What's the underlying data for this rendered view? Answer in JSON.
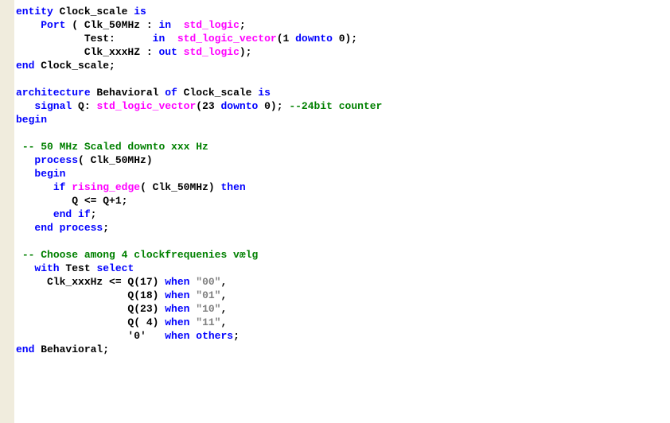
{
  "tokens": [
    [
      [
        "kw",
        "entity"
      ],
      [
        "id",
        " Clock_scale "
      ],
      [
        "kw",
        "is"
      ]
    ],
    [
      [
        "id",
        "    "
      ],
      [
        "kw",
        "Port"
      ],
      [
        "id",
        " ( Clk_50MHz : "
      ],
      [
        "kw",
        "in"
      ],
      [
        "id",
        "  "
      ],
      [
        "type",
        "std_logic"
      ],
      [
        "id",
        ";"
      ]
    ],
    [
      [
        "id",
        "           Test:      "
      ],
      [
        "kw",
        "in"
      ],
      [
        "id",
        "  "
      ],
      [
        "type",
        "std_logic_vector"
      ],
      [
        "id",
        "(1 "
      ],
      [
        "kw",
        "downto"
      ],
      [
        "id",
        " 0);"
      ]
    ],
    [
      [
        "id",
        "           Clk_xxxHZ : "
      ],
      [
        "kw",
        "out"
      ],
      [
        "id",
        " "
      ],
      [
        "type",
        "std_logic"
      ],
      [
        "id",
        ");"
      ]
    ],
    [
      [
        "kw",
        "end"
      ],
      [
        "id",
        " Clock_scale;"
      ]
    ],
    [],
    [
      [
        "kw",
        "architecture"
      ],
      [
        "id",
        " Behavioral "
      ],
      [
        "kw",
        "of"
      ],
      [
        "id",
        " Clock_scale "
      ],
      [
        "kw",
        "is"
      ]
    ],
    [
      [
        "id",
        "   "
      ],
      [
        "kw",
        "signal"
      ],
      [
        "id",
        " Q: "
      ],
      [
        "type",
        "std_logic_vector"
      ],
      [
        "id",
        "(23 "
      ],
      [
        "kw",
        "downto"
      ],
      [
        "id",
        " 0); "
      ],
      [
        "cmt",
        "--24bit counter"
      ]
    ],
    [
      [
        "kw",
        "begin"
      ]
    ],
    [],
    [
      [
        "id",
        " "
      ],
      [
        "cmt",
        "-- 50 MHz Scaled downto xxx Hz"
      ]
    ],
    [
      [
        "id",
        "   "
      ],
      [
        "kw",
        "process"
      ],
      [
        "id",
        "( Clk_50MHz)"
      ]
    ],
    [
      [
        "id",
        "   "
      ],
      [
        "kw",
        "begin"
      ]
    ],
    [
      [
        "id",
        "      "
      ],
      [
        "kw",
        "if"
      ],
      [
        "id",
        " "
      ],
      [
        "type",
        "rising_edge"
      ],
      [
        "id",
        "( Clk_50MHz) "
      ],
      [
        "kw",
        "then"
      ]
    ],
    [
      [
        "id",
        "         Q <= Q+1;"
      ]
    ],
    [
      [
        "id",
        "      "
      ],
      [
        "kw",
        "end"
      ],
      [
        "id",
        " "
      ],
      [
        "kw",
        "if"
      ],
      [
        "id",
        ";"
      ]
    ],
    [
      [
        "id",
        "   "
      ],
      [
        "kw",
        "end"
      ],
      [
        "id",
        " "
      ],
      [
        "kw",
        "process"
      ],
      [
        "id",
        ";"
      ]
    ],
    [],
    [
      [
        "id",
        " "
      ],
      [
        "cmt",
        "-- Choose among 4 clockfrequenies vælg"
      ]
    ],
    [
      [
        "id",
        "   "
      ],
      [
        "kw",
        "with"
      ],
      [
        "id",
        " Test "
      ],
      [
        "kw",
        "select"
      ]
    ],
    [
      [
        "id",
        "     Clk_xxxHz <= Q(17) "
      ],
      [
        "kw",
        "when"
      ],
      [
        "id",
        " "
      ],
      [
        "str",
        "\"00\""
      ],
      [
        "id",
        ","
      ]
    ],
    [
      [
        "id",
        "                  Q(18) "
      ],
      [
        "kw",
        "when"
      ],
      [
        "id",
        " "
      ],
      [
        "str",
        "\"01\""
      ],
      [
        "id",
        ","
      ]
    ],
    [
      [
        "id",
        "                  Q(23) "
      ],
      [
        "kw",
        "when"
      ],
      [
        "id",
        " "
      ],
      [
        "str",
        "\"10\""
      ],
      [
        "id",
        ","
      ]
    ],
    [
      [
        "id",
        "                  Q( 4) "
      ],
      [
        "kw",
        "when"
      ],
      [
        "id",
        " "
      ],
      [
        "str",
        "\"11\""
      ],
      [
        "id",
        ","
      ]
    ],
    [
      [
        "id",
        "                  '0'   "
      ],
      [
        "kw",
        "when"
      ],
      [
        "id",
        " "
      ],
      [
        "kw",
        "others"
      ],
      [
        "id",
        ";"
      ]
    ],
    [
      [
        "kw",
        "end"
      ],
      [
        "id",
        " Behavioral;"
      ]
    ]
  ]
}
